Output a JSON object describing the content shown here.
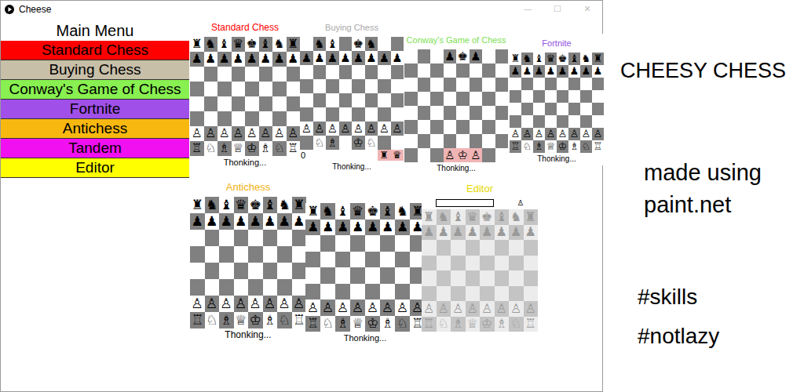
{
  "window": {
    "title": "Cheese",
    "controls": [
      "—",
      "☐",
      "✕"
    ]
  },
  "menu": {
    "title": "Main Menu",
    "items": [
      {
        "label": "Standard Chess",
        "color": "#ff0000"
      },
      {
        "label": "Buying Chess",
        "color": "#c8bfa8"
      },
      {
        "label": "Conway's Game of Chess",
        "color": "#88f050"
      },
      {
        "label": "Fortnite",
        "color": "#a050e8"
      },
      {
        "label": "Antichess",
        "color": "#f8b810"
      },
      {
        "label": "Tandem",
        "color": "#f010f0"
      },
      {
        "label": "Editor",
        "color": "#ffff00"
      }
    ]
  },
  "boards": [
    {
      "title": "Standard Chess",
      "titleColor": "#ff0000",
      "faded": false,
      "status": "Thonking...",
      "highlights": [],
      "rows": [
        "♜♞♝♛♚♝♞♜",
        "♟♟♟♟♟♟♟♟",
        "        ",
        "        ",
        "        ",
        "        ",
        "♙♙♙♙♙♙♙♙",
        "♖♘♗♕♔♗♘♖"
      ]
    },
    {
      "title": "Buying Chess",
      "titleColor": "#a8a8a8",
      "faded": false,
      "status": "Thonking...",
      "highlights": [],
      "counter": "0",
      "shop": [
        "♜",
        "♛"
      ],
      "rows": [
        " ♞♝ ♚♞  ",
        "♟♟♟♟♟♟♟♟",
        "        ",
        "        ",
        "        ",
        "        ",
        "♙♙♙♙♙♙♙♙",
        " ♘♗ ♔♘  "
      ]
    },
    {
      "title": "Conway's Game of Chess",
      "titleColor": "#7ce050",
      "faded": false,
      "status": "Thonking...",
      "highlights": [
        [
          7,
          3
        ],
        [
          7,
          4
        ],
        [
          7,
          5
        ]
      ],
      "rows": [
        "   ♟♚♟  ",
        "        ",
        "        ",
        "        ",
        "        ",
        "        ",
        "        ",
        "   ♙♔♙  "
      ]
    },
    {
      "title": "Fortnite",
      "titleColor": "#9050e0",
      "faded": false,
      "status": "Thonking...",
      "highlights": [],
      "rows": [
        "♜♞♝♛♚♝♞♜",
        "♟♟♟♟♟♟♟♟",
        "        ",
        "        ",
        "        ",
        "        ",
        "♙♙♙♙♙♙♙♙",
        "♖♘♗♕♔♗♘♖"
      ]
    },
    {
      "title": "Antichess",
      "titleColor": "#f0b010",
      "faded": false,
      "status": "Thonking...",
      "highlights": [],
      "rows": [
        "♜♞♝♛♚♝♞♜",
        "♟♟♟♟♟♟♟♟",
        "        ",
        "        ",
        "        ",
        "        ",
        "♙♙♙♙♙♙♙♙",
        "♖♘♗♕♔♗♘♖"
      ]
    },
    {
      "title": "",
      "titleColor": "#f010f0",
      "faded": false,
      "status": "Thonking...",
      "highlights": [],
      "rows": [
        "♜♞♝♛♚♝♞♜",
        "♟♟♟♟♟♟♟♟",
        "        ",
        "        ",
        "        ",
        "        ",
        "♙♙♙♙♙♙♙♙",
        "♖♘♗♕♔♗♘♖"
      ]
    },
    {
      "title": "Editor",
      "titleColor": "#e6d800",
      "faded": true,
      "status": "",
      "highlights": [],
      "search": "",
      "palette": "♙",
      "rows": [
        "♜♞♝♛♚♝♞♜",
        "♟♟♟♟♟♟♟♟",
        "        ",
        "        ",
        "        ",
        "        ",
        "♙♙♙♙♙♙♙♙",
        "♖♘♗♕♔♗♘♖"
      ]
    }
  ],
  "caption": {
    "heading": "CHEESY CHESS",
    "lines": [
      "made using",
      "paint.net"
    ],
    "tags": [
      "#skills",
      "#notlazy"
    ]
  }
}
